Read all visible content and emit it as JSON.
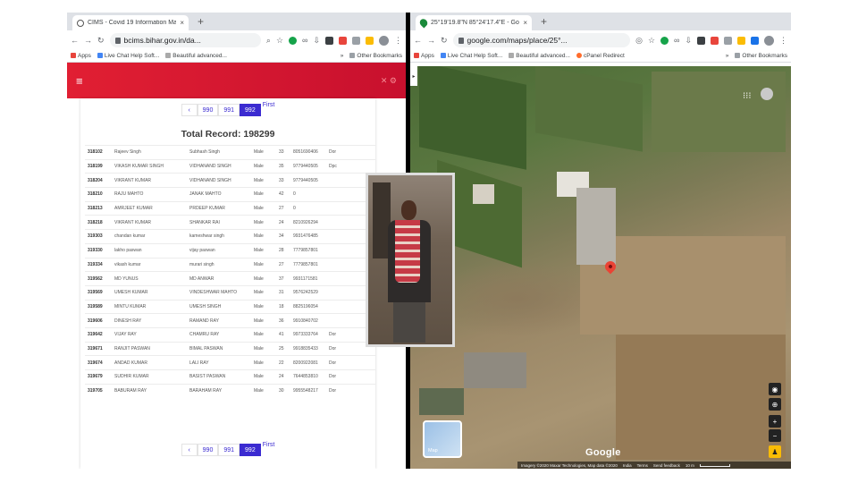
{
  "left_browser": {
    "tab_title": "CIMS - Covid 19 Information Ma",
    "tab_close": "×",
    "new_tab": "+",
    "url": "bcims.bihar.gov.in/da...",
    "bookmarks": [
      {
        "label": "Apps"
      },
      {
        "label": "Live Chat Help Soft..."
      },
      {
        "label": "Beautiful advanced..."
      }
    ],
    "overflow": "»",
    "other_bookmarks": "Other Bookmarks"
  },
  "app": {
    "menu_icon": "≡",
    "header_icons": "✕ ⚙",
    "pager_top": {
      "prev": "‹",
      "pages": [
        "990",
        "991",
        "992"
      ],
      "active_page": "992",
      "first": "First"
    },
    "total_record": "Total Record: 198299",
    "table_rows": [
      {
        "id": "318102",
        "name": "Rajeev Singh",
        "father": "Subhash Singh",
        "gender": "Male",
        "age": "33",
        "phone": "8051690406",
        "extra": "Dor"
      },
      {
        "id": "318199",
        "name": "VIKASH KUMAR SINGH",
        "father": "VIDHANAND SINGH",
        "gender": "Male",
        "age": "35",
        "phone": "9779440505",
        "extra": "Dpc"
      },
      {
        "id": "318204",
        "name": "VIKRANT KUMAR",
        "father": "VIDHANAND SINGH",
        "gender": "Male",
        "age": "33",
        "phone": "9779440505",
        "extra": ""
      },
      {
        "id": "318210",
        "name": "RAJU MAHTO",
        "father": "JANAK MAHTO",
        "gender": "Male",
        "age": "42",
        "phone": "0",
        "extra": ""
      },
      {
        "id": "318213",
        "name": "AMRJEET KUMAR",
        "father": "PRDEEP KUMAR",
        "gender": "Male",
        "age": "27",
        "phone": "0",
        "extra": ""
      },
      {
        "id": "318218",
        "name": "VIKRANT KUMAR",
        "father": "SHANKAR RAI",
        "gender": "Male",
        "age": "24",
        "phone": "8210926294",
        "extra": ""
      },
      {
        "id": "319303",
        "name": "chandan kumar",
        "father": "kameshwar singh",
        "gender": "Male",
        "age": "34",
        "phone": "9931476485",
        "extra": ""
      },
      {
        "id": "319330",
        "name": "lakho paswan",
        "father": "vijay paswan",
        "gender": "Male",
        "age": "28",
        "phone": "7779857801",
        "extra": ""
      },
      {
        "id": "319334",
        "name": "vikash kumar",
        "father": "murari singh",
        "gender": "Male",
        "age": "27",
        "phone": "7779857801",
        "extra": ""
      },
      {
        "id": "319562",
        "name": "MD YUNUS",
        "father": "MD ANWAR",
        "gender": "Male",
        "age": "37",
        "phone": "9931171581",
        "extra": ""
      },
      {
        "id": "319569",
        "name": "UMESH KUMAR",
        "father": "VINDESHWAR MAHTO",
        "gender": "Male",
        "age": "31",
        "phone": "9576242529",
        "extra": ""
      },
      {
        "id": "319589",
        "name": "MINTU KUMAR",
        "father": "UMESH SINGH",
        "gender": "Male",
        "age": "18",
        "phone": "8825196054",
        "extra": ""
      },
      {
        "id": "319606",
        "name": "DINESH RAY",
        "father": "RAMAND RAY",
        "gender": "Male",
        "age": "36",
        "phone": "9910840702",
        "extra": ""
      },
      {
        "id": "319642",
        "name": "VIJAY RAY",
        "father": "CHAMRU RAY",
        "gender": "Male",
        "age": "41",
        "phone": "9973333764",
        "extra": "Dor"
      },
      {
        "id": "319671",
        "name": "RANJIT PASWAN",
        "father": "BIMAL PASWAN",
        "gender": "Male",
        "age": "25",
        "phone": "9918835433",
        "extra": "Dor"
      },
      {
        "id": "319674",
        "name": "ANDAD KUMAR",
        "father": "LALI RAY",
        "gender": "Male",
        "age": "22",
        "phone": "8200922081",
        "extra": "Dor"
      },
      {
        "id": "319679",
        "name": "SUDHIR KUMAR",
        "father": "BASIST PASWAN",
        "gender": "Male",
        "age": "24",
        "phone": "7644853810",
        "extra": "Dor"
      },
      {
        "id": "319705",
        "name": "BABURAM RAY",
        "father": "BARAHAM RAY",
        "gender": "Male",
        "age": "30",
        "phone": "9955548217",
        "extra": "Dor"
      }
    ],
    "pager_bottom": {
      "prev": "‹",
      "pages": [
        "990",
        "991",
        "992"
      ],
      "active_page": "992",
      "first": "First"
    }
  },
  "right_browser": {
    "tab_title": "25°19'19.8\"N 85°24'17.4\"E - Go",
    "tab_close": "×",
    "new_tab": "+",
    "url": "google.com/maps/place/25°...",
    "bookmarks": [
      {
        "label": "Apps"
      },
      {
        "label": "Live Chat Help Soft..."
      },
      {
        "label": "Beautiful advanced..."
      },
      {
        "label": "cPanel Redirect"
      }
    ],
    "overflow": "»",
    "other_bookmarks": "Other Bookmarks"
  },
  "map": {
    "side_toggle": "▸",
    "grid_icon": "⁝⁝⁝",
    "controls": [
      "◉",
      "⊕",
      "+",
      "−"
    ],
    "pegman": "♟",
    "mini_map_label": "Map",
    "logo": "Google",
    "attribution": "Imagery ©2020 Maxar Technologies, Map data ©2020",
    "attribution_links": [
      "India",
      "Terms",
      "Send feedback"
    ],
    "scale": "10 m"
  },
  "colors": {
    "app_header": "#d4142a",
    "active_page": "#3b2bd1",
    "pin": "#ea4335"
  }
}
